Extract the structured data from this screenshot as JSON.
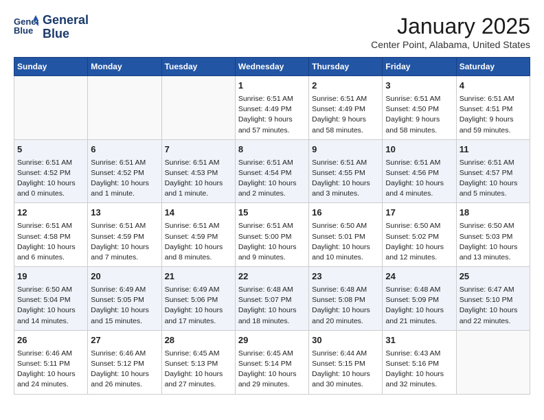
{
  "logo": {
    "line1": "General",
    "line2": "Blue"
  },
  "title": "January 2025",
  "subtitle": "Center Point, Alabama, United States",
  "weekdays": [
    "Sunday",
    "Monday",
    "Tuesday",
    "Wednesday",
    "Thursday",
    "Friday",
    "Saturday"
  ],
  "weeks": [
    [
      {
        "day": "",
        "content": ""
      },
      {
        "day": "",
        "content": ""
      },
      {
        "day": "",
        "content": ""
      },
      {
        "day": "1",
        "content": "Sunrise: 6:51 AM\nSunset: 4:49 PM\nDaylight: 9 hours and 57 minutes."
      },
      {
        "day": "2",
        "content": "Sunrise: 6:51 AM\nSunset: 4:49 PM\nDaylight: 9 hours and 58 minutes."
      },
      {
        "day": "3",
        "content": "Sunrise: 6:51 AM\nSunset: 4:50 PM\nDaylight: 9 hours and 58 minutes."
      },
      {
        "day": "4",
        "content": "Sunrise: 6:51 AM\nSunset: 4:51 PM\nDaylight: 9 hours and 59 minutes."
      }
    ],
    [
      {
        "day": "5",
        "content": "Sunrise: 6:51 AM\nSunset: 4:52 PM\nDaylight: 10 hours and 0 minutes."
      },
      {
        "day": "6",
        "content": "Sunrise: 6:51 AM\nSunset: 4:52 PM\nDaylight: 10 hours and 1 minute."
      },
      {
        "day": "7",
        "content": "Sunrise: 6:51 AM\nSunset: 4:53 PM\nDaylight: 10 hours and 1 minute."
      },
      {
        "day": "8",
        "content": "Sunrise: 6:51 AM\nSunset: 4:54 PM\nDaylight: 10 hours and 2 minutes."
      },
      {
        "day": "9",
        "content": "Sunrise: 6:51 AM\nSunset: 4:55 PM\nDaylight: 10 hours and 3 minutes."
      },
      {
        "day": "10",
        "content": "Sunrise: 6:51 AM\nSunset: 4:56 PM\nDaylight: 10 hours and 4 minutes."
      },
      {
        "day": "11",
        "content": "Sunrise: 6:51 AM\nSunset: 4:57 PM\nDaylight: 10 hours and 5 minutes."
      }
    ],
    [
      {
        "day": "12",
        "content": "Sunrise: 6:51 AM\nSunset: 4:58 PM\nDaylight: 10 hours and 6 minutes."
      },
      {
        "day": "13",
        "content": "Sunrise: 6:51 AM\nSunset: 4:59 PM\nDaylight: 10 hours and 7 minutes."
      },
      {
        "day": "14",
        "content": "Sunrise: 6:51 AM\nSunset: 4:59 PM\nDaylight: 10 hours and 8 minutes."
      },
      {
        "day": "15",
        "content": "Sunrise: 6:51 AM\nSunset: 5:00 PM\nDaylight: 10 hours and 9 minutes."
      },
      {
        "day": "16",
        "content": "Sunrise: 6:50 AM\nSunset: 5:01 PM\nDaylight: 10 hours and 10 minutes."
      },
      {
        "day": "17",
        "content": "Sunrise: 6:50 AM\nSunset: 5:02 PM\nDaylight: 10 hours and 12 minutes."
      },
      {
        "day": "18",
        "content": "Sunrise: 6:50 AM\nSunset: 5:03 PM\nDaylight: 10 hours and 13 minutes."
      }
    ],
    [
      {
        "day": "19",
        "content": "Sunrise: 6:50 AM\nSunset: 5:04 PM\nDaylight: 10 hours and 14 minutes."
      },
      {
        "day": "20",
        "content": "Sunrise: 6:49 AM\nSunset: 5:05 PM\nDaylight: 10 hours and 15 minutes."
      },
      {
        "day": "21",
        "content": "Sunrise: 6:49 AM\nSunset: 5:06 PM\nDaylight: 10 hours and 17 minutes."
      },
      {
        "day": "22",
        "content": "Sunrise: 6:48 AM\nSunset: 5:07 PM\nDaylight: 10 hours and 18 minutes."
      },
      {
        "day": "23",
        "content": "Sunrise: 6:48 AM\nSunset: 5:08 PM\nDaylight: 10 hours and 20 minutes."
      },
      {
        "day": "24",
        "content": "Sunrise: 6:48 AM\nSunset: 5:09 PM\nDaylight: 10 hours and 21 minutes."
      },
      {
        "day": "25",
        "content": "Sunrise: 6:47 AM\nSunset: 5:10 PM\nDaylight: 10 hours and 22 minutes."
      }
    ],
    [
      {
        "day": "26",
        "content": "Sunrise: 6:46 AM\nSunset: 5:11 PM\nDaylight: 10 hours and 24 minutes."
      },
      {
        "day": "27",
        "content": "Sunrise: 6:46 AM\nSunset: 5:12 PM\nDaylight: 10 hours and 26 minutes."
      },
      {
        "day": "28",
        "content": "Sunrise: 6:45 AM\nSunset: 5:13 PM\nDaylight: 10 hours and 27 minutes."
      },
      {
        "day": "29",
        "content": "Sunrise: 6:45 AM\nSunset: 5:14 PM\nDaylight: 10 hours and 29 minutes."
      },
      {
        "day": "30",
        "content": "Sunrise: 6:44 AM\nSunset: 5:15 PM\nDaylight: 10 hours and 30 minutes."
      },
      {
        "day": "31",
        "content": "Sunrise: 6:43 AM\nSunset: 5:16 PM\nDaylight: 10 hours and 32 minutes."
      },
      {
        "day": "",
        "content": ""
      }
    ]
  ]
}
